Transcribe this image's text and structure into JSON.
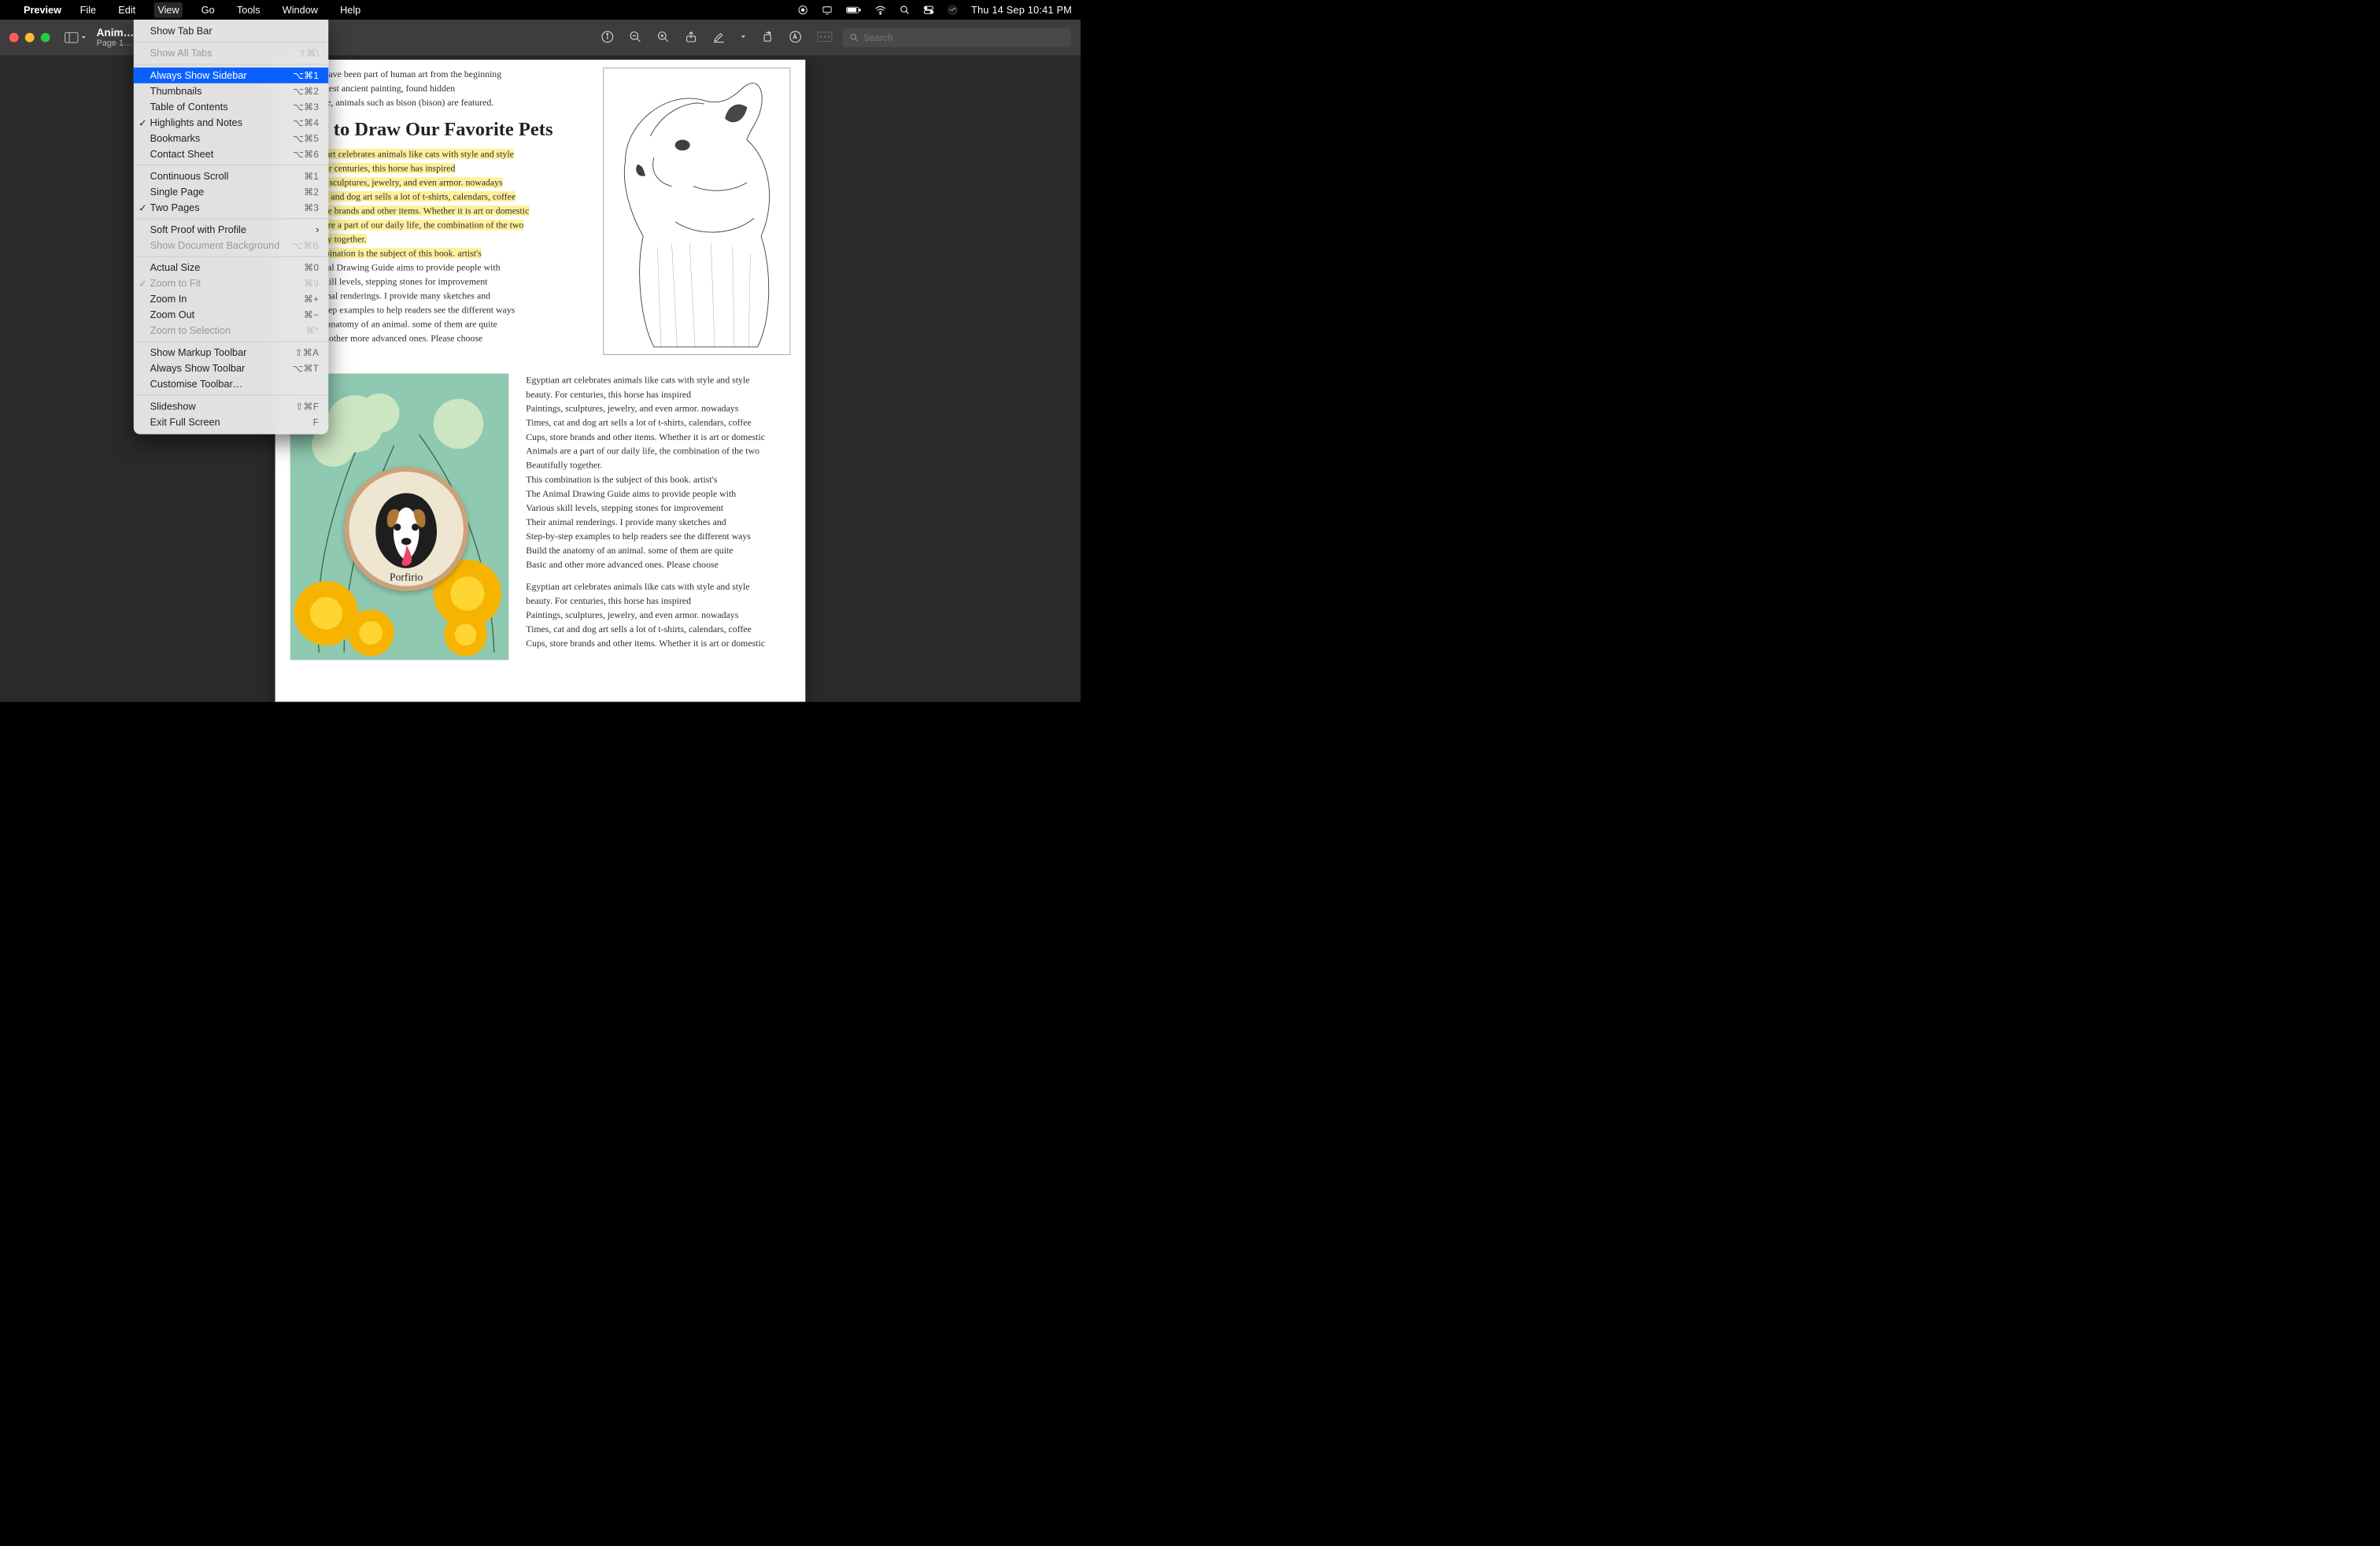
{
  "menubar": {
    "app": "Preview",
    "items": [
      "File",
      "Edit",
      "View",
      "Go",
      "Tools",
      "Window",
      "Help"
    ],
    "active_index": 2,
    "clock": "Thu 14 Sep  10:41 PM"
  },
  "window": {
    "title": "Anim…",
    "subtitle": "Page 1…",
    "search_placeholder": "Search"
  },
  "view_menu": [
    {
      "label": "Show Tab Bar",
      "shortcut": "",
      "state": ""
    },
    {
      "sep": true
    },
    {
      "label": "Show All Tabs",
      "shortcut": "⇧⌘\\",
      "state": "disabled"
    },
    {
      "sep": true
    },
    {
      "label": "Always Show Sidebar",
      "shortcut": "⌥⌘1",
      "state": "selected"
    },
    {
      "label": "Thumbnails",
      "shortcut": "⌥⌘2",
      "state": ""
    },
    {
      "label": "Table of Contents",
      "shortcut": "⌥⌘3",
      "state": ""
    },
    {
      "label": "Highlights and Notes",
      "shortcut": "⌥⌘4",
      "state": "checked"
    },
    {
      "label": "Bookmarks",
      "shortcut": "⌥⌘5",
      "state": ""
    },
    {
      "label": "Contact Sheet",
      "shortcut": "⌥⌘6",
      "state": ""
    },
    {
      "sep": true
    },
    {
      "label": "Continuous Scroll",
      "shortcut": "⌘1",
      "state": ""
    },
    {
      "label": "Single Page",
      "shortcut": "⌘2",
      "state": ""
    },
    {
      "label": "Two Pages",
      "shortcut": "⌘3",
      "state": "checked"
    },
    {
      "sep": true
    },
    {
      "label": "Soft Proof with Profile",
      "shortcut": "",
      "state": "",
      "submenu": true
    },
    {
      "label": "Show Document Background",
      "shortcut": "⌥⌘B",
      "state": "disabled"
    },
    {
      "sep": true
    },
    {
      "label": "Actual Size",
      "shortcut": "⌘0",
      "state": ""
    },
    {
      "label": "Zoom to Fit",
      "shortcut": "⌘9",
      "state": "disabled-checked"
    },
    {
      "label": "Zoom In",
      "shortcut": "⌘+",
      "state": ""
    },
    {
      "label": "Zoom Out",
      "shortcut": "⌘−",
      "state": ""
    },
    {
      "label": "Zoom to Selection",
      "shortcut": "⌘*",
      "state": "disabled"
    },
    {
      "sep": true
    },
    {
      "label": "Show Markup Toolbar",
      "shortcut": "⇧⌘A",
      "state": ""
    },
    {
      "label": "Always Show Toolbar",
      "shortcut": "⌥⌘T",
      "state": ""
    },
    {
      "label": "Customise Toolbar…",
      "shortcut": "",
      "state": ""
    },
    {
      "sep": true
    },
    {
      "label": "Slideshow",
      "shortcut": "⇧⌘F",
      "state": ""
    },
    {
      "label": "Exit Full Screen",
      "shortcut": "F",
      "state": ""
    }
  ],
  "doc": {
    "intro": [
      "Animals have been part of human art from the beginning",
      "start. Earliest ancient painting, found hidden",
      "In the cave, animals such as bison (bison) are featured."
    ],
    "heading": "How to Draw Our Favorite Pets",
    "high": [
      "Egyptian art celebrates animals like cats with style and style",
      "beauty. For centuries, this horse has inspired",
      "Paintings, sculptures, jewelry, and even armor. nowadays",
      "Times, cat and dog art sells a lot of t-shirts, calendars, coffee",
      "Cups, store brands and other items. Whether it is art or domestic",
      "Animals are a part of our daily life, the combination of the two",
      "Beautifully together.",
      "This combination is the subject of this book. artist's"
    ],
    "after_high": [
      "The Animal Drawing Guide aims to provide people with",
      "Various skill levels, stepping stones for improvement",
      "Their animal renderings. I provide many sketches and",
      "Step-by-step examples to help readers see the different ways",
      "Build the anatomy of an animal. some of them are quite",
      "Basic and other more advanced ones. Please choose"
    ],
    "right_col": [
      "Egyptian art celebrates animals like cats with style and style",
      "beauty. For centuries, this horse has inspired",
      "Paintings, sculptures, jewelry, and even armor. nowadays",
      "Times, cat and dog art sells a lot of t-shirts, calendars, coffee",
      "Cups, store brands and other items. Whether it is art or domestic",
      "Animals are a part of our daily life, the combination of the two",
      "Beautifully together.",
      "This combination is the subject of this book. artist's",
      "The Animal Drawing Guide aims to provide people with",
      "Various skill levels, stepping stones for improvement",
      "Their animal renderings. I provide many sketches and",
      "Step-by-step examples to help readers see the different ways",
      "Build the anatomy of an animal. some of them are quite",
      "Basic and other more advanced ones. Please choose",
      "",
      "Egyptian art celebrates animals like cats with style and style",
      "beauty. For centuries, this horse has inspired",
      "Paintings, sculptures, jewelry, and even armor. nowadays",
      "Times, cat and dog art sells a lot of t-shirts, calendars, coffee",
      "Cups, store brands and other items. Whether it is art or domestic"
    ],
    "embroid_label": "Porfirio"
  }
}
